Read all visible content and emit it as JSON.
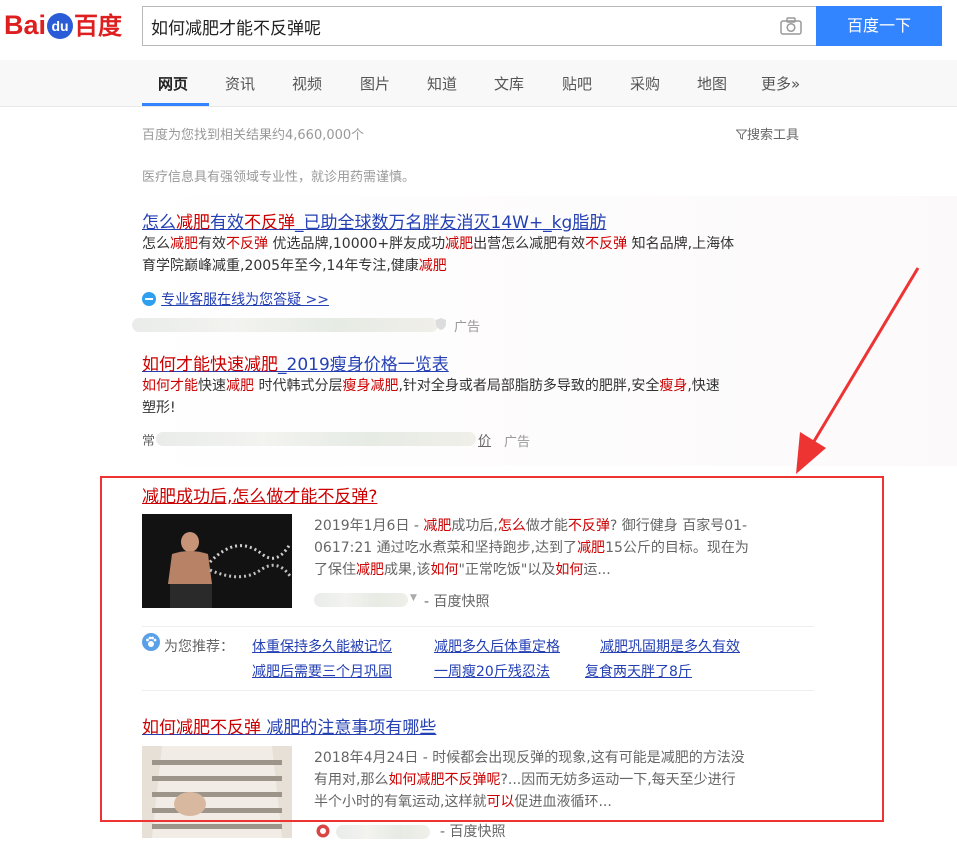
{
  "logo": {
    "latin": "Bai",
    "paw": "du",
    "chinese": "百度"
  },
  "search": {
    "query": "如何减肥才能不反弹呢",
    "button_label": "百度一下"
  },
  "tabs": [
    {
      "label": "网页",
      "active": true
    },
    {
      "label": "资讯"
    },
    {
      "label": "视频"
    },
    {
      "label": "图片"
    },
    {
      "label": "知道"
    },
    {
      "label": "文库"
    },
    {
      "label": "贴吧"
    },
    {
      "label": "采购"
    },
    {
      "label": "地图"
    },
    {
      "label": "更多»"
    }
  ],
  "stats": {
    "text": "百度为您找到相关结果约4,660,000个",
    "tools_label": "搜索工具"
  },
  "notice": "医疗信息具有强领域专业性，就诊用药需谨慎。",
  "ad1": {
    "title_parts": [
      "怎么",
      "减肥",
      "有效",
      "不反弹",
      "_已助全球数万名胖友消灭14W+_kg脂肪"
    ],
    "desc_line1_parts": [
      "怎么",
      "减肥",
      "有效",
      "不反弹",
      " 优选品牌,10000+胖友成功",
      "减肥",
      "出营怎么减肥有效",
      "不反弹",
      " 知名品牌,上海体"
    ],
    "desc_line2_parts": [
      "育学院巅峰减重,2005年至今,14年专注,健康",
      "减肥"
    ],
    "service_link": "专业客服在线为您答疑 >>",
    "ad_label": "广告"
  },
  "ad2": {
    "title_parts": [
      "如何才能快速减肥",
      "_2019瘦身价格一览表"
    ],
    "desc_line1_parts": [
      "如何才能",
      "快速",
      "减肥",
      " 时代韩式分层",
      "瘦身减肥",
      ",针对全身或者局部脂肪多导致的肥胖,安全",
      "瘦身",
      ",快速"
    ],
    "desc_line2": "塑形!",
    "url_prefix": "常",
    "url_suffix": "价",
    "ad_label": "广告"
  },
  "result1": {
    "title": "减肥成功后,怎么做才能不反弹?",
    "desc_line1_parts": [
      "2019年1月6日 - ",
      "减肥",
      "成功后,",
      "怎么",
      "做才能",
      "不反弹",
      "? 御行健身 百家号01-"
    ],
    "desc_line2_parts": [
      "0617:21 通过吃水煮菜和坚持跑步,达到了",
      "减肥",
      "15公斤的目标。现在为"
    ],
    "desc_line3_parts": [
      "了保住",
      "减肥",
      "成果,该",
      "如何",
      "\"正常吃饭\"以及",
      "如何",
      "运..."
    ],
    "snapshot": "- 百度快照"
  },
  "recommend": {
    "label": "为您推荐：",
    "links": [
      "体重保持多久能被记忆",
      "减肥多久后体重定格",
      "减肥巩固期是多久有效",
      "减肥后需要三个月巩固",
      "一周瘦20斤残忍法",
      "复食两天胖了8斤"
    ]
  },
  "result2": {
    "title_parts": [
      "如何减肥不反弹",
      " 减肥的注意事项有哪些"
    ],
    "desc_line1": "2018年4月24日 - 时候都会出现反弹的现象,这有可能是减肥的方法没",
    "desc_line2_parts": [
      "有用对,那么",
      "如何减肥不反弹呢",
      "?...因而无妨多运动一下,每天至少进行"
    ],
    "desc_line3_parts": [
      "半个小时的有氧运动,这样就",
      "可以",
      "促进血液循环..."
    ],
    "snapshot": "- 百度快照"
  },
  "colors": {
    "accent": "#3385ff",
    "link": "#2440b3",
    "highlight": "#cc0000",
    "annotation": "#e33333"
  }
}
